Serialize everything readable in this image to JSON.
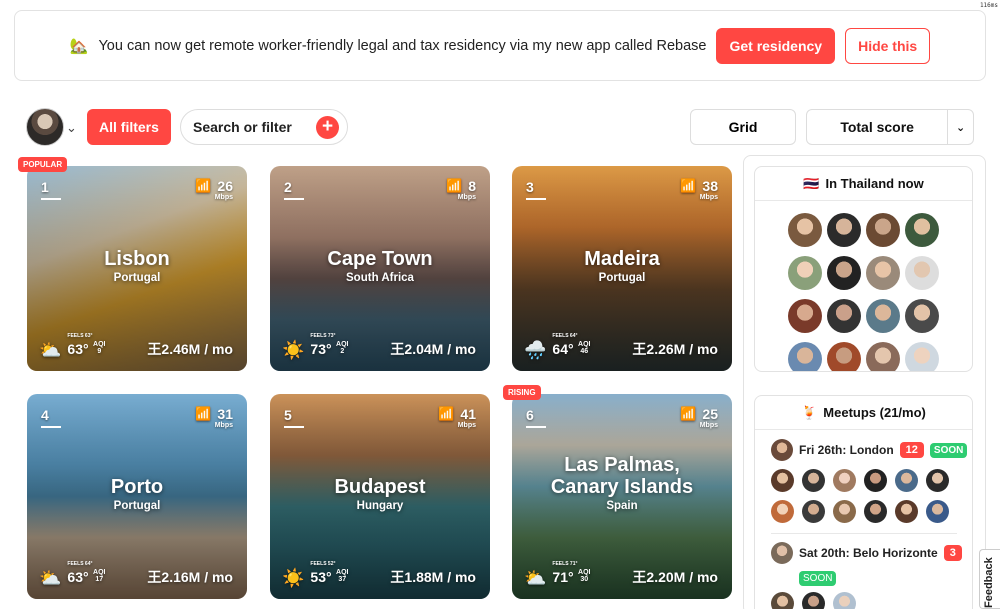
{
  "timing": "116ms",
  "banner": {
    "icon": "🏡",
    "text": "You can now get remote worker-friendly legal and tax residency via my new app called Rebase",
    "cta_primary": "Get residency",
    "cta_secondary": "Hide this"
  },
  "toolbar": {
    "filters_label": "All filters",
    "search_label": "Search or filter",
    "plus": "+",
    "view_label": "Grid",
    "sort_label": "Total score",
    "sort_chevron": "⌄",
    "avatar_chevron": "⌄"
  },
  "cards": [
    {
      "rank": "1",
      "city": "Lisbon",
      "country": "Portugal",
      "wifi": "26",
      "wifi_unit": "Mbps",
      "feels": "FEELS 63°",
      "temp": "63°",
      "aqi_label": "AQI",
      "aqi": "9",
      "cost": "王2.46M / mo",
      "weather_icon": "⛅",
      "tag": "POPULAR"
    },
    {
      "rank": "2",
      "city": "Cape Town",
      "country": "South Africa",
      "wifi": "8",
      "wifi_unit": "Mbps",
      "feels": "FEELS 73°",
      "temp": "73°",
      "aqi_label": "AQI",
      "aqi": "2",
      "cost": "王2.04M / mo",
      "weather_icon": "☀️",
      "tag": ""
    },
    {
      "rank": "3",
      "city": "Madeira",
      "country": "Portugal",
      "wifi": "38",
      "wifi_unit": "Mbps",
      "feels": "FEELS 64°",
      "temp": "64°",
      "aqi_label": "AQI",
      "aqi": "46",
      "cost": "王2.26M / mo",
      "weather_icon": "🌧️",
      "tag": ""
    },
    {
      "rank": "4",
      "city": "Porto",
      "country": "Portugal",
      "wifi": "31",
      "wifi_unit": "Mbps",
      "feels": "FEELS 64°",
      "temp": "63°",
      "aqi_label": "AQI",
      "aqi": "17",
      "cost": "王2.16M / mo",
      "weather_icon": "⛅",
      "tag": ""
    },
    {
      "rank": "5",
      "city": "Budapest",
      "country": "Hungary",
      "wifi": "41",
      "wifi_unit": "Mbps",
      "feels": "FEELS 52°",
      "temp": "53°",
      "aqi_label": "AQI",
      "aqi": "37",
      "cost": "王1.88M / mo",
      "weather_icon": "☀️",
      "tag": ""
    },
    {
      "rank": "6",
      "city": "Las Palmas, Canary Islands",
      "country": "Spain",
      "wifi": "25",
      "wifi_unit": "Mbps",
      "feels": "FEELS 71°",
      "temp": "71°",
      "aqi_label": "AQI",
      "aqi": "30",
      "cost": "王2.20M / mo",
      "weather_icon": "⛅",
      "tag": "RISING"
    }
  ],
  "sidebar": {
    "now_flag": "🇹🇭",
    "now_title": "In Thailand now",
    "meetups_icon": "🍹",
    "meetups_title": "Meetups (21/mo)",
    "meetups": [
      {
        "label": "Fri 26th: London",
        "count": "12",
        "status": "SOON"
      },
      {
        "label": "Sat 20th: Belo Horizonte",
        "count": "3",
        "status": "SOON"
      }
    ]
  },
  "feedback": "Feedback",
  "colors": {
    "accent": "#ff4742",
    "soon": "#2ecc71"
  }
}
